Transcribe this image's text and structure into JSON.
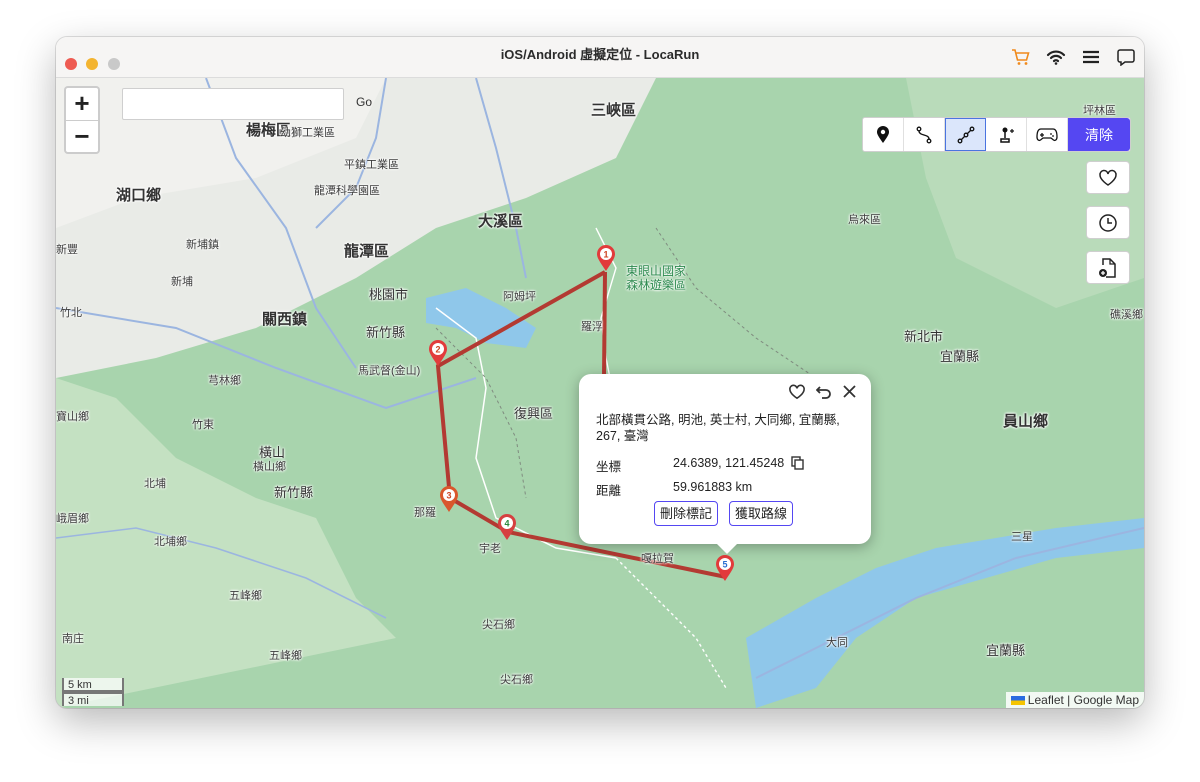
{
  "window": {
    "title": "iOS/Android 虛擬定位 - LocaRun",
    "traffic_colors": [
      "#ee5b52",
      "#f3b430",
      "#c9c9c9"
    ]
  },
  "map": {
    "search": {
      "value": "",
      "placeholder": ""
    },
    "go_label": "Go",
    "zoom_in": "+",
    "zoom_out": "−",
    "clear_label": "清除",
    "labels": [
      "三峽區",
      "楊梅區",
      "湖口鄉",
      "大溪區",
      "龍潭區",
      "新埔鎮",
      "新埔",
      "關西鎮",
      "新竹縣",
      "桃園市",
      "芎林鄉",
      "竹東",
      "橫山",
      "橫山鄉",
      "新竹縣",
      "北埔",
      "北埔鄉",
      "峨眉鄉",
      "寶山鄉",
      "五峰鄉",
      "五峰鄉",
      "尖石鄉",
      "尖石鄉",
      "東眼山國家",
      "森林遊樂區",
      "烏來區",
      "員山鄉",
      "宜蘭縣",
      "大同",
      "三星",
      "坪林區",
      "礁溪鄉",
      "新北市",
      "宜蘭縣",
      "復興區",
      "平鎮工業區",
      "幼獅工業區",
      "龍潭科學園區",
      "馬武督(金山)",
      "阿姆坪",
      "羅浮",
      "嘎拉賀",
      "宇老",
      "那羅",
      "新豐",
      "南庄",
      "竹北"
    ],
    "markers": [
      "1",
      "2",
      "3",
      "4",
      "5"
    ],
    "route_color": "#b33a32",
    "scale": {
      "km": "5 km",
      "mi": "3 mi"
    },
    "attribution": {
      "leaflet": "Leaflet",
      "sep": " | ",
      "google": "Google Map"
    }
  },
  "popup": {
    "address": "北部橫貫公路, 明池, 英士村, 大同鄉, 宜蘭縣, 267, 臺灣",
    "coord_label": "坐標",
    "coord_value": "24.6389, 121.45248",
    "distance_label": "距離",
    "distance_value": "59.961883 km",
    "delete_button": "刪除標記",
    "route_button": "獲取路線"
  },
  "accent": "#5547f2"
}
